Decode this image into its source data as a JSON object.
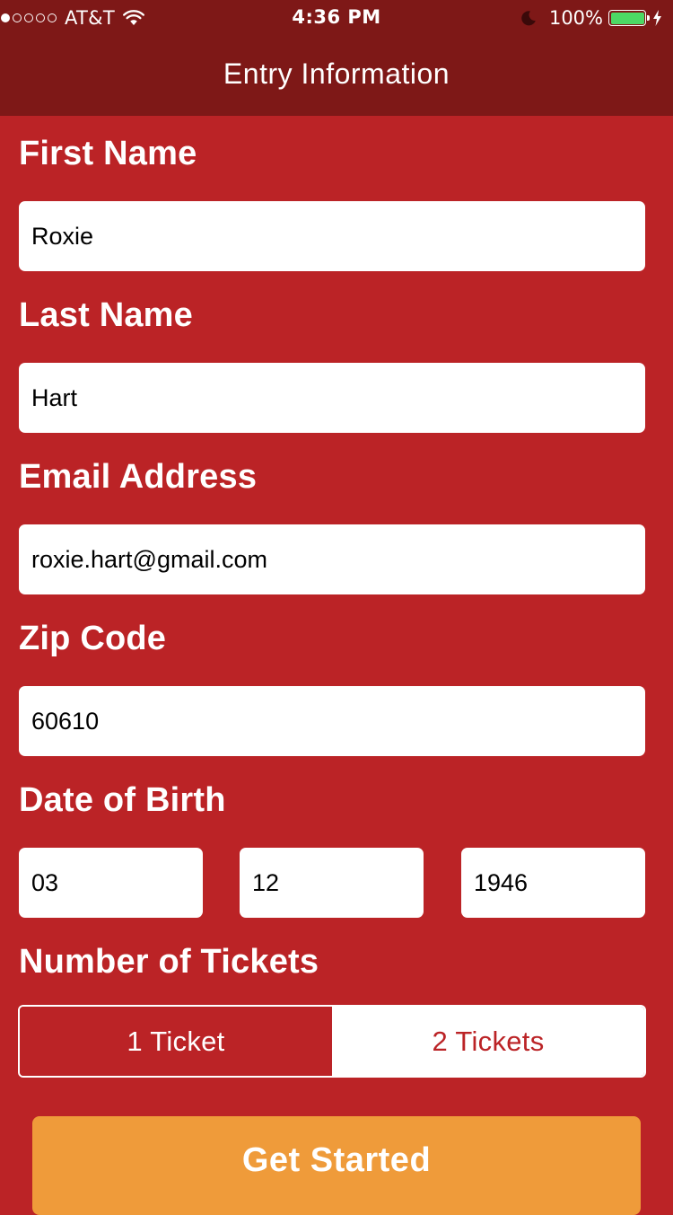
{
  "status_bar": {
    "carrier": "AT&T",
    "time": "4:36 PM",
    "battery_percent": "100%",
    "signal_bars_filled": 1,
    "signal_bars_total": 5,
    "battery_level": 1.0
  },
  "nav": {
    "title": "Entry Information"
  },
  "form": {
    "first_name": {
      "label": "First Name",
      "value": "Roxie"
    },
    "last_name": {
      "label": "Last Name",
      "value": "Hart"
    },
    "email": {
      "label": "Email Address",
      "value": "roxie.hart@gmail.com"
    },
    "zip": {
      "label": "Zip Code",
      "value": "60610"
    },
    "dob": {
      "label": "Date of Birth",
      "month": "03",
      "day": "12",
      "year": "1946"
    },
    "tickets": {
      "label": "Number of Tickets",
      "options": [
        "1 Ticket",
        "2 Tickets"
      ],
      "selected": "1 Ticket"
    }
  },
  "cta": {
    "label": "Get Started"
  },
  "colors": {
    "background": "#bb2326",
    "navbar": "#7e1817",
    "cta": "#ef9b3a",
    "battery": "#4cd964"
  }
}
